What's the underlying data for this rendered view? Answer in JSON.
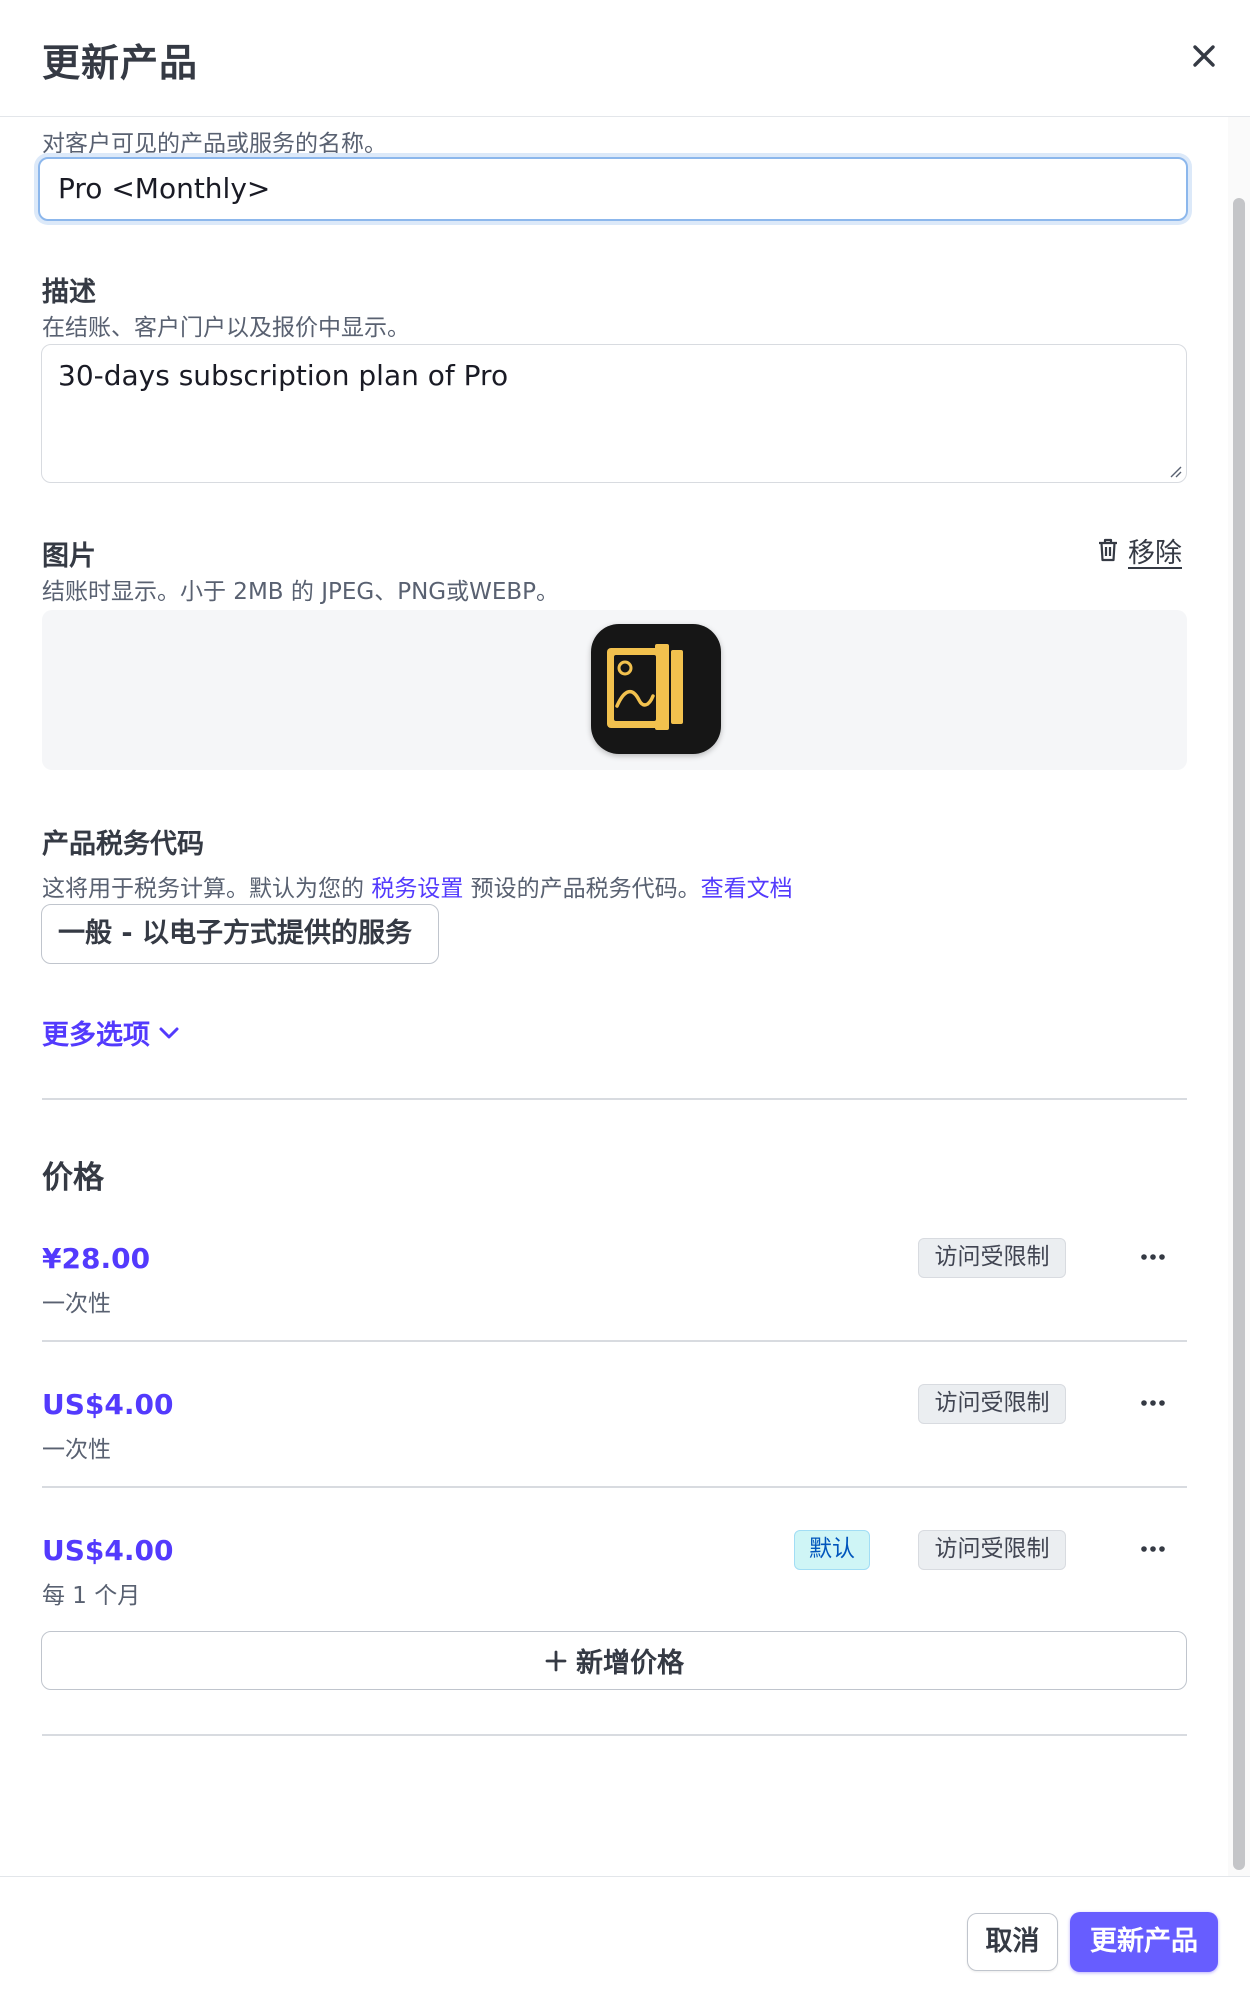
{
  "header": {
    "title": "更新产品",
    "close_icon": "close-icon"
  },
  "name_field": {
    "helper": "对客户可见的产品或服务的名称。",
    "value": "Pro <Monthly>"
  },
  "description_field": {
    "label": "描述",
    "helper": "在结账、客户门户以及报价中显示。",
    "value": "30-days subscription plan of Pro"
  },
  "image_field": {
    "label": "图片",
    "helper": "结账时显示。小于 2MB 的 JPEG、PNG或WEBP。",
    "remove_label": "移除",
    "remove_icon": "trash-icon",
    "image_icon": "gallery-app-icon",
    "icon_colors": {
      "background": "#161616",
      "accent": "#f2c14e"
    }
  },
  "tax_code": {
    "label": "产品税务代码",
    "helper_prefix": "这将用于税务计算。默认为您的",
    "helper_link_settings": "税务设置",
    "helper_middle": "预设的产品税务代码。",
    "helper_link_docs": "查看文档",
    "selected_value": "一般 - 以电子方式提供的服务"
  },
  "more_options": {
    "label": "更多选项",
    "icon": "chevron-down-icon"
  },
  "prices": {
    "title": "价格",
    "items": [
      {
        "amount": "¥28.00",
        "interval": "一次性",
        "default_badge": "",
        "restricted_badge": "访问受限制"
      },
      {
        "amount": "US$4.00",
        "interval": "一次性",
        "default_badge": "",
        "restricted_badge": "访问受限制"
      },
      {
        "amount": "US$4.00",
        "interval": "每 1 个月",
        "default_badge": "默认",
        "restricted_badge": "访问受限制"
      }
    ],
    "add_price_label": "新增价格",
    "add_icon": "plus-icon",
    "more_icon": "more-horizontal-icon"
  },
  "footer": {
    "cancel_label": "取消",
    "submit_label": "更新产品"
  },
  "colors": {
    "accent": "#533afd",
    "primary_button": "#675dff",
    "focus_ring": "#8cb7ec"
  }
}
